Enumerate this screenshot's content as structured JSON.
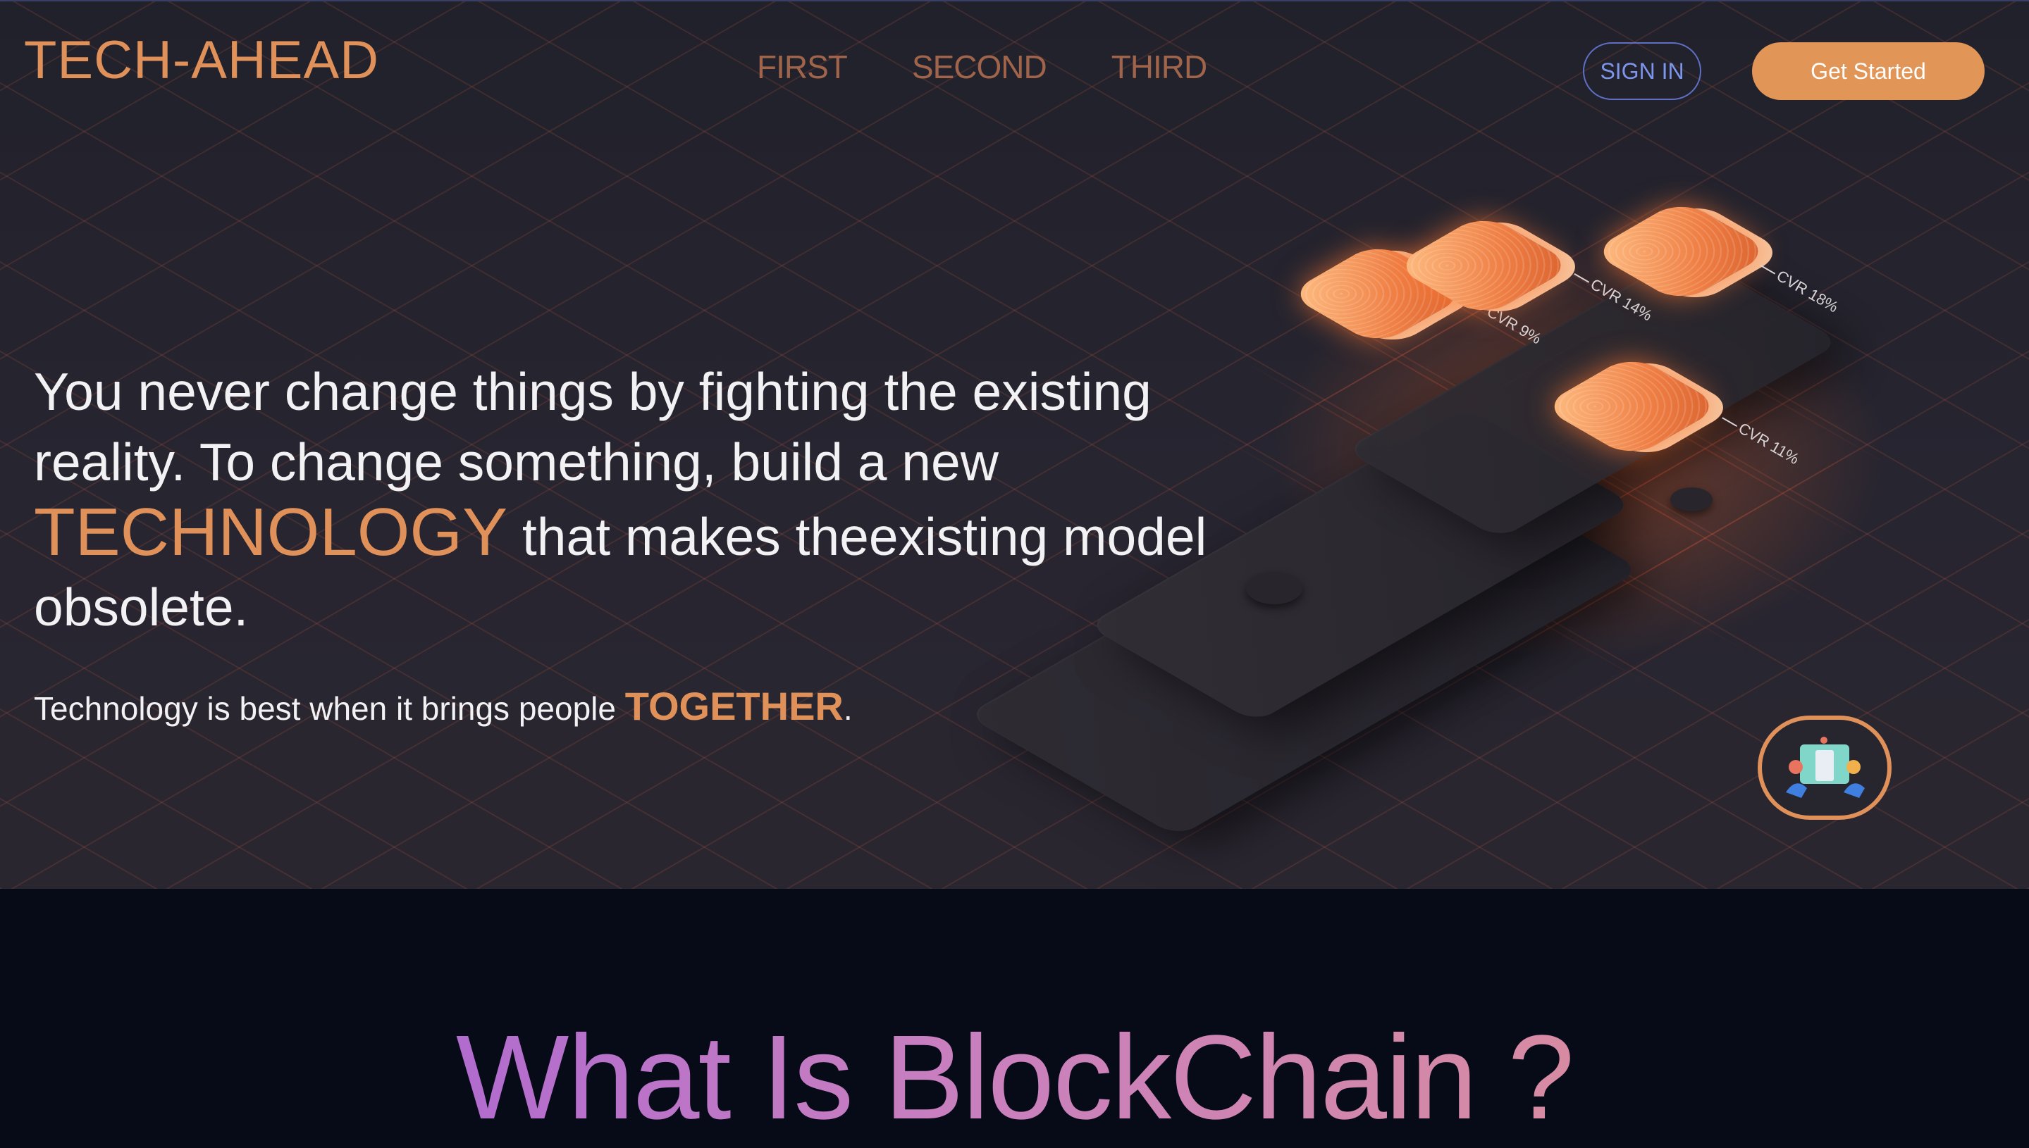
{
  "brand": {
    "logo_text": "TECH-AHEAD",
    "accent_color": "#e0915a"
  },
  "nav": {
    "links": [
      "FIRST",
      "SECOND",
      "THIRD"
    ],
    "sign_in_label": "SIGN IN",
    "get_started_label": "Get Started"
  },
  "hero": {
    "quote_part1": "You never change things by fighting the existing reality. To change something, build a new ",
    "quote_accent": "TECHNOLOGY",
    "quote_part2": " that makes theexisting model obsolete.",
    "tagline_part1": "Technology is best when it brings people ",
    "tagline_accent": "TOGETHER",
    "tagline_part2": "."
  },
  "illustration": {
    "tiles": [
      {
        "label": "CVR 9%"
      },
      {
        "label": "CVR 14%"
      },
      {
        "label": "CVR 18%"
      },
      {
        "label": "CVR 11%"
      }
    ],
    "chat_icon": "team-chat-icon"
  },
  "section_blockchain": {
    "title": "What Is BlockChain ?"
  }
}
